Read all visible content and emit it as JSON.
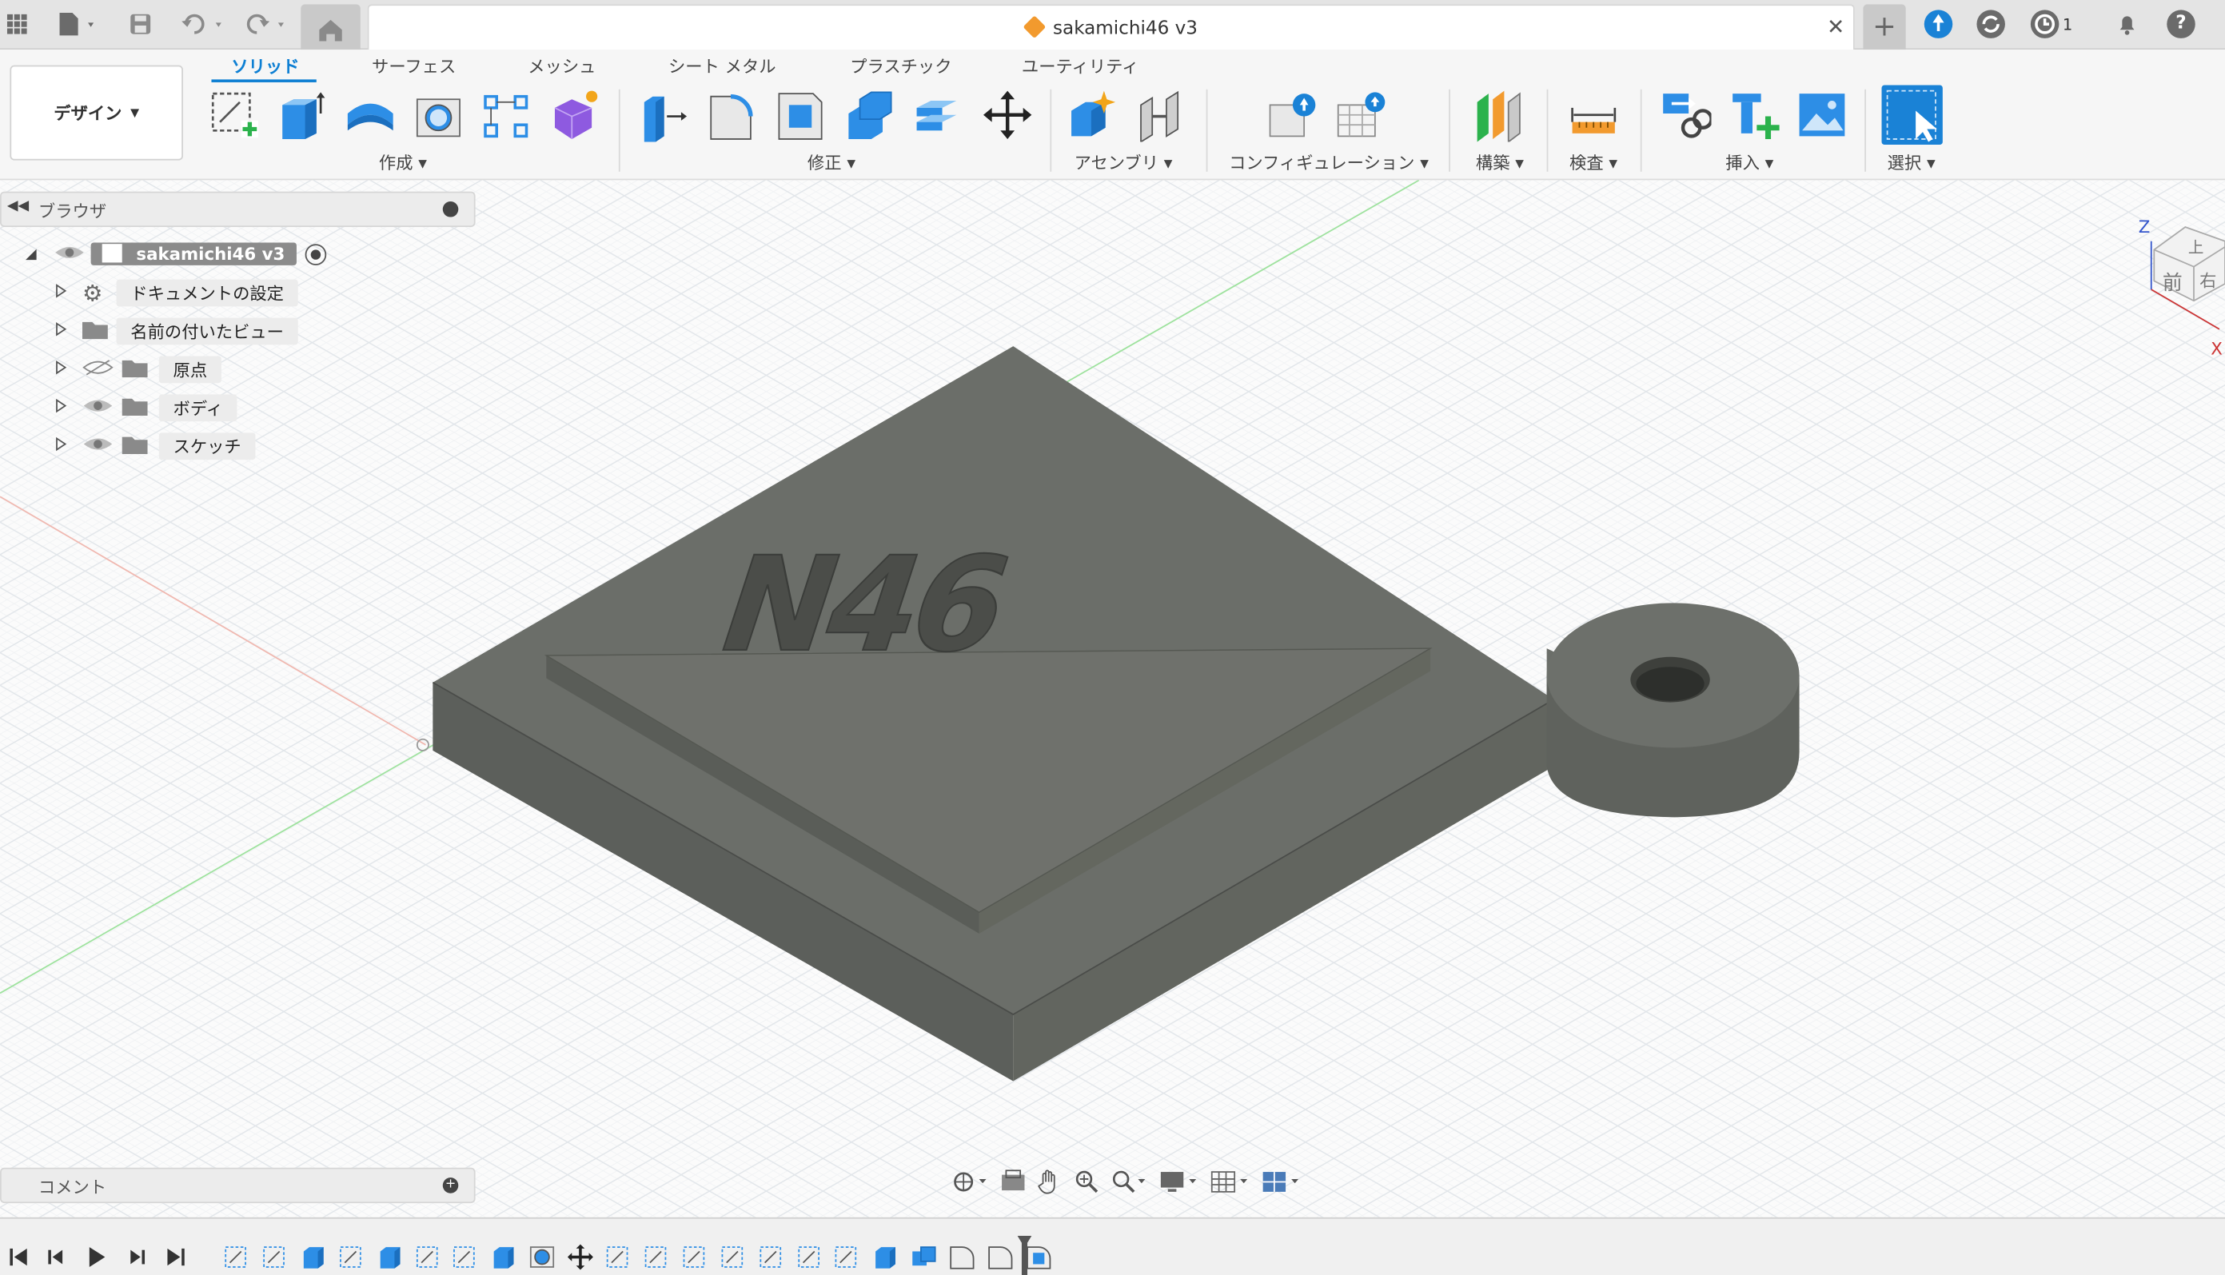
{
  "window": {
    "title": "sakamichi46 v3",
    "update_count": "1"
  },
  "workspace": {
    "mode_label": "デザイン"
  },
  "tabs": [
    "ソリッド",
    "サーフェス",
    "メッシュ",
    "シート メタル",
    "プラスチック",
    "ユーティリティ"
  ],
  "active_tab": "ソリッド",
  "groups": {
    "create": "作成",
    "modify": "修正",
    "assemble": "アセンブリ",
    "configure": "コンフィギュレーション",
    "construct": "構築",
    "inspect": "検査",
    "insert": "挿入",
    "select": "選択"
  },
  "browser": {
    "title": "ブラウザ",
    "root": "sakamichi46 v3",
    "items": [
      {
        "label": "ドキュメントの設定",
        "icon": "gear-icon"
      },
      {
        "label": "名前の付いたビュー",
        "icon": "folder-icon"
      },
      {
        "label": "原点",
        "icon": "folder-icon",
        "visibility": "hidden"
      },
      {
        "label": "ボディ",
        "icon": "folder-icon",
        "visibility": "visible"
      },
      {
        "label": "スケッチ",
        "icon": "folder-icon",
        "visibility": "visible"
      }
    ]
  },
  "model": {
    "emboss_text": "N46"
  },
  "viewcube": {
    "axis_z": "Z",
    "axis_x": "X",
    "face_front": "前",
    "face_top": "上",
    "face_right": "右"
  },
  "comments": {
    "title": "コメント"
  },
  "colors": {
    "accent": "#0d7fd3",
    "ribbon_bg": "#f6f6f6",
    "model_body": "#6b6e69",
    "grid": "#e2e6ea"
  }
}
